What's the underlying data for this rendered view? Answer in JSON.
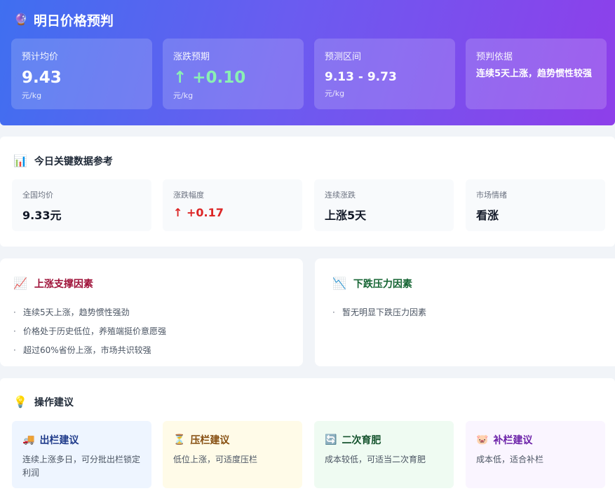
{
  "header": {
    "icon": "fortune-teller-icon",
    "title": "明日价格预判",
    "cards": [
      {
        "label": "预计均价",
        "value": "9.43",
        "unit": "元/kg"
      },
      {
        "label": "涨跌预期",
        "value": "↑ +0.10",
        "unit": "元/kg",
        "color": "#8af0b4"
      },
      {
        "label": "预测区间",
        "value": "9.13 - 9.73",
        "unit": "元/kg"
      },
      {
        "label": "预判依据",
        "note": "连续5天上涨，趋势惯性较强"
      }
    ]
  },
  "reference": {
    "icon": "bar-chart-icon",
    "title": "今日关键数据参考",
    "cards": [
      {
        "label": "全国均价",
        "value": "9.33元"
      },
      {
        "label": "涨跌幅度",
        "value": "↑ +0.17",
        "color": "#dc2626"
      },
      {
        "label": "连续涨跌",
        "value": "上涨5天"
      },
      {
        "label": "市场情绪",
        "value": "看涨"
      }
    ]
  },
  "factors": {
    "up": {
      "icon": "chart-increasing-icon",
      "title": "上涨支撑因素",
      "items": [
        "连续5天上涨，趋势惯性强劲",
        "价格处于历史低位，养殖端挺价意愿强",
        "超过60%省份上涨，市场共识较强"
      ]
    },
    "down": {
      "icon": "chart-decreasing-icon",
      "title": "下跌压力因素",
      "items": [
        "暂无明显下跌压力因素"
      ]
    }
  },
  "advice": {
    "icon": "lightbulb-icon",
    "title": "操作建议",
    "cards": [
      {
        "icon": "truck-icon",
        "title": "出栏建议",
        "body": "连续上涨多日，可分批出栏锁定利润",
        "bg": "#eef5ff",
        "title_color": "#1e3a8a"
      },
      {
        "icon": "hourglass-icon",
        "title": "压栏建议",
        "body": "低位上涨，可适度压栏",
        "bg": "#fffbe8",
        "title_color": "#854d0e"
      },
      {
        "icon": "cycle-icon",
        "title": "二次育肥",
        "body": "成本较低，可适当二次育肥",
        "bg": "#effbf2",
        "title_color": "#14532d"
      },
      {
        "icon": "pig-icon",
        "title": "补栏建议",
        "body": "成本低，适合补栏",
        "bg": "#faf5ff",
        "title_color": "#6b21a8"
      }
    ]
  }
}
